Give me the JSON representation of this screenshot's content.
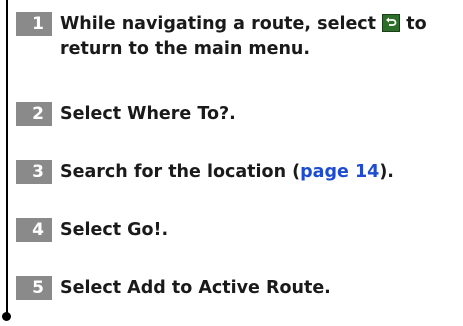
{
  "steps": [
    {
      "number": "1",
      "text_before_icon": "While navigating a route, select",
      "text_after_icon": "to return to the main menu."
    },
    {
      "number": "2",
      "text": "Select Where To?."
    },
    {
      "number": "3",
      "text_before_link": "Search for the location (",
      "link_text": "page 14",
      "text_after_link": ")."
    },
    {
      "number": "4",
      "text": "Select Go!."
    },
    {
      "number": "5",
      "text": "Select Add to Active Route."
    }
  ],
  "icons": {
    "back_icon": "back-arrow-icon",
    "back_icon_color": "#2d6e2a"
  },
  "colors": {
    "step_number_background": "#8a8a8a",
    "link": "#1d4cd0"
  }
}
